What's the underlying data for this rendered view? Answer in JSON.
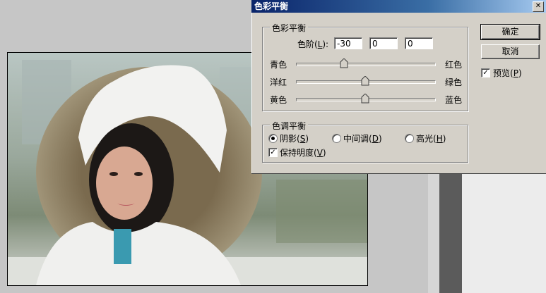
{
  "dialog": {
    "title": "色彩平衡",
    "close_glyph": "✕"
  },
  "color_balance": {
    "legend": "色彩平衡",
    "levels_label_prefix": "色阶(",
    "levels_label_key": "L",
    "levels_label_suffix": "):",
    "levels": [
      "-30",
      "0",
      "0"
    ],
    "sliders": [
      {
        "left_label": "青色",
        "right_label": "红色",
        "value": -30
      },
      {
        "left_label": "洋红",
        "right_label": "绿色",
        "value": 0
      },
      {
        "left_label": "黄色",
        "right_label": "蓝色",
        "value": 0
      }
    ]
  },
  "tone_balance": {
    "legend": "色调平衡",
    "shadows": {
      "text": "阴影(",
      "key": "S",
      "suffix": ")",
      "selected": true
    },
    "midtones": {
      "text": "中间调(",
      "key": "D",
      "suffix": ")",
      "selected": false
    },
    "highlights": {
      "text": "高光(",
      "key": "H",
      "suffix": ")",
      "selected": false
    },
    "preserve": {
      "text": "保持明度(",
      "key": "V",
      "suffix": ")",
      "checked": true
    }
  },
  "buttons": {
    "ok": "确定",
    "cancel": "取消"
  },
  "preview": {
    "text": "预览(",
    "key": "P",
    "suffix": ")",
    "checked": true
  },
  "check_glyph": "✓"
}
